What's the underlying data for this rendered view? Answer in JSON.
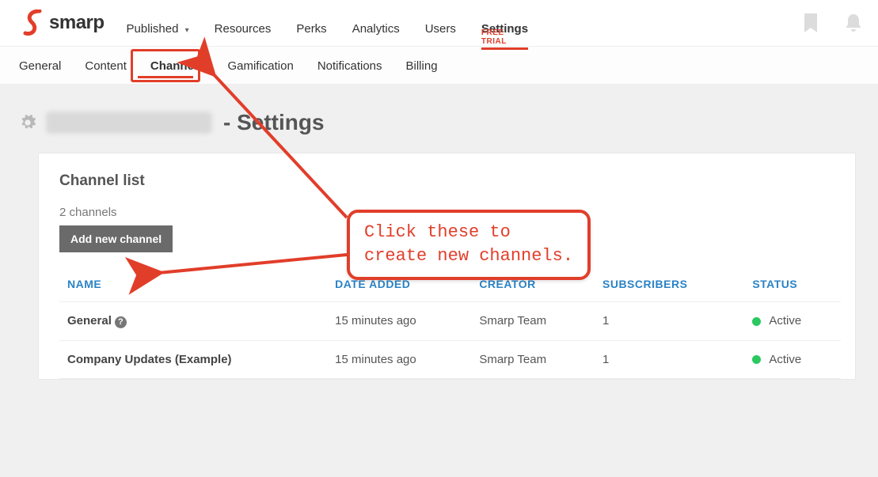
{
  "brand": "smarp",
  "topnav": {
    "items": [
      {
        "label": "Published",
        "caret": true
      },
      {
        "label": "Resources"
      },
      {
        "label": "Perks"
      },
      {
        "label": "Analytics"
      },
      {
        "label": "Users"
      },
      {
        "label": "Settings",
        "active": true,
        "free_trial": "FREE TRIAL"
      }
    ]
  },
  "subnav": {
    "items": [
      "General",
      "Content",
      "Channels",
      "Gamification",
      "Notifications",
      "Billing"
    ],
    "active": "Channels"
  },
  "page": {
    "title_suffix": "- Settings",
    "card_title": "Channel list",
    "count_label": "2 channels",
    "add_button": "Add new channel"
  },
  "table": {
    "headers": [
      "NAME",
      "DATE ADDED",
      "CREATOR",
      "SUBSCRIBERS",
      "STATUS"
    ],
    "rows": [
      {
        "name": "General",
        "help": true,
        "date": "15 minutes ago",
        "creator": "Smarp Team",
        "subs": "1",
        "status": "Active"
      },
      {
        "name": "Company Updates (Example)",
        "help": false,
        "date": "15 minutes ago",
        "creator": "Smarp Team",
        "subs": "1",
        "status": "Active"
      }
    ]
  },
  "annotation": {
    "callout_line1": "Click these to",
    "callout_line2": "create new channels."
  }
}
